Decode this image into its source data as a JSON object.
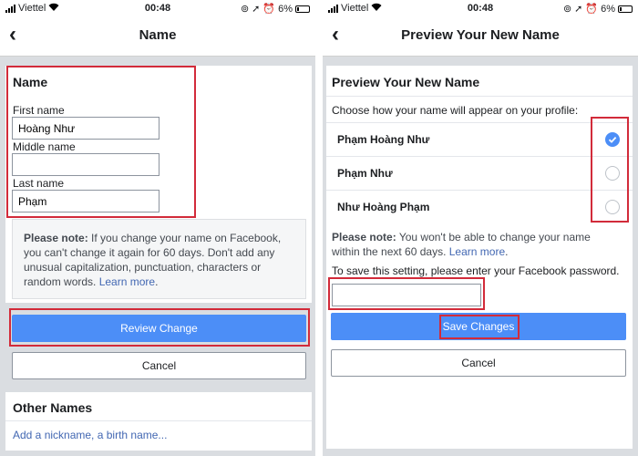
{
  "status": {
    "carrier": "Viettel",
    "time": "00:48",
    "battery": "6%"
  },
  "left": {
    "nav_title": "Name",
    "section_title": "Name",
    "first_name_label": "First name",
    "first_name_value": "Hoàng Như",
    "middle_name_label": "Middle name",
    "middle_name_value": "",
    "last_name_label": "Last name",
    "last_name_value": "Phạm",
    "note_bold": "Please note:",
    "note_text": " If you change your name on Facebook, you can't change it again for 60 days. Don't add any unusual capitalization, punctuation, characters or random words. ",
    "note_link": "Learn more",
    "note_end": ".",
    "review_button": "Review Change",
    "cancel_button": "Cancel",
    "other_names_title": "Other Names",
    "other_names_link": "Add a nickname, a birth name..."
  },
  "right": {
    "nav_title": "Preview Your New Name",
    "section_title": "Preview Your New Name",
    "instruction": "Choose how your name will appear on your profile:",
    "options": [
      {
        "label": "Phạm Hoàng Như",
        "selected": true
      },
      {
        "label": "Phạm Như",
        "selected": false
      },
      {
        "label": "Như Hoàng Phạm",
        "selected": false
      }
    ],
    "note_bold": "Please note:",
    "note_text": " You won't be able to change your name within the next 60 days. ",
    "note_link": "Learn more",
    "note_end": ".",
    "password_prompt": "To save this setting, please enter your Facebook password.",
    "password_value": "",
    "save_button": "Save Changes",
    "cancel_button": "Cancel"
  },
  "colors": {
    "accent": "#4c8ef7",
    "highlight": "#d22b3a",
    "link": "#4267b2",
    "background": "#dadde1"
  }
}
